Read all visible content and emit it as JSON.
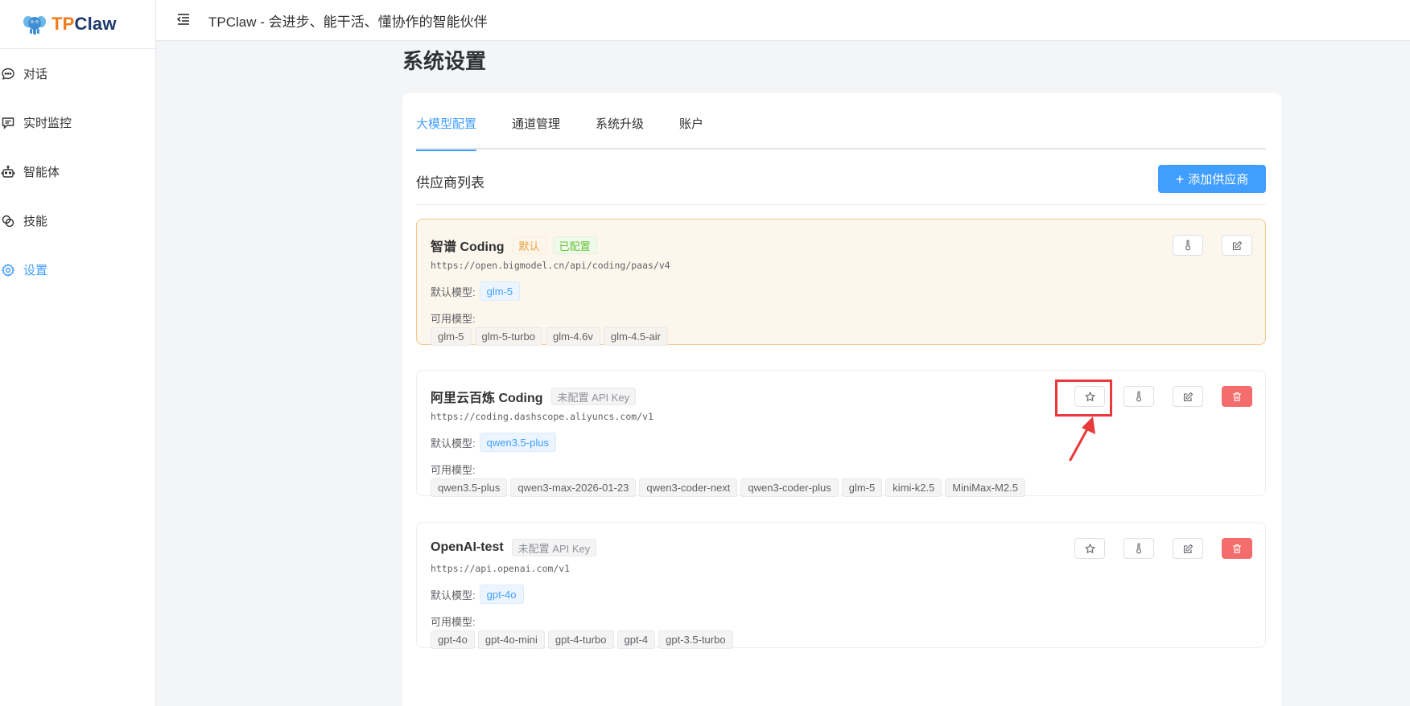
{
  "app": {
    "logo_tp": "TP",
    "logo_claw": "Claw"
  },
  "header": {
    "title": "TPClaw - 会进步、能干活、懂协作的智能伙伴"
  },
  "sidebar": {
    "items": [
      {
        "label": "对话",
        "icon": "chat-icon"
      },
      {
        "label": "实时监控",
        "icon": "monitor-icon"
      },
      {
        "label": "智能体",
        "icon": "robot-icon"
      },
      {
        "label": "技能",
        "icon": "skills-icon"
      },
      {
        "label": "设置",
        "icon": "gear-icon",
        "active": true
      }
    ]
  },
  "page": {
    "title": "系统设置"
  },
  "tabs": [
    {
      "label": "大模型配置",
      "active": true
    },
    {
      "label": "通道管理"
    },
    {
      "label": "系统升级"
    },
    {
      "label": "账户"
    }
  ],
  "list": {
    "title": "供应商列表",
    "add_button": "添加供应商"
  },
  "labels": {
    "default_model": "默认模型:",
    "available_models": "可用模型:"
  },
  "providers": [
    {
      "name": "智谱 Coding",
      "tags": [
        "默认",
        "已配置"
      ],
      "url": "https://open.bigmodel.cn/api/coding/paas/v4",
      "default_model": "glm-5",
      "models": [
        "glm-5",
        "glm-5-turbo",
        "glm-4.6v",
        "glm-4.5-air"
      ]
    },
    {
      "name": "阿里云百炼 Coding",
      "tags": [
        "未配置 API Key"
      ],
      "url": "https://coding.dashscope.aliyuncs.com/v1",
      "default_model": "qwen3.5-plus",
      "models": [
        "qwen3.5-plus",
        "qwen3-max-2026-01-23",
        "qwen3-coder-next",
        "qwen3-coder-plus",
        "glm-5",
        "kimi-k2.5",
        "MiniMax-M2.5"
      ]
    },
    {
      "name": "OpenAI-test",
      "tags": [
        "未配置 API Key"
      ],
      "url": "https://api.openai.com/v1",
      "default_model": "gpt-4o",
      "models": [
        "gpt-4o",
        "gpt-4o-mini",
        "gpt-4-turbo",
        "gpt-4",
        "gpt-3.5-turbo"
      ]
    }
  ],
  "colors": {
    "accent": "#409eff",
    "danger": "#f56c6c",
    "default_card_bg": "#fdf6ec",
    "annotation": "#e8393b"
  }
}
